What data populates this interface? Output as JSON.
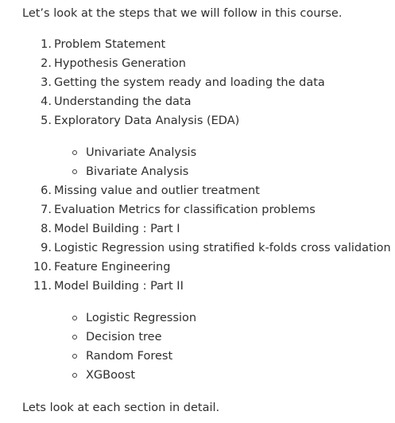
{
  "intro": "Let’s look at the steps that we will follow in this course.",
  "steps": [
    {
      "num": "1.",
      "text": "Problem Statement"
    },
    {
      "num": "2.",
      "text": "Hypothesis Generation"
    },
    {
      "num": "3.",
      "text": "Getting the system ready and loading the data"
    },
    {
      "num": "4.",
      "text": "Understanding the data"
    },
    {
      "num": "5.",
      "text": "Exploratory Data Analysis (EDA)"
    },
    {
      "num": "6.",
      "text": "Missing value and outlier treatment"
    },
    {
      "num": "7.",
      "text": "Evaluation Metrics for classification problems"
    },
    {
      "num": "8.",
      "text": "Model Building : Part I"
    },
    {
      "num": "9.",
      "text": "Logistic Regression using stratified k-folds cross validation"
    },
    {
      "num": "10.",
      "text": "Feature Engineering"
    },
    {
      "num": "11.",
      "text": "Model Building : Part II"
    }
  ],
  "eda_subitems": [
    "Univariate Analysis",
    "Bivariate Analysis"
  ],
  "model_subitems": [
    "Logistic Regression",
    "Decision tree",
    "Random Forest",
    "XGBoost"
  ],
  "outro": "Lets look at each section in detail."
}
